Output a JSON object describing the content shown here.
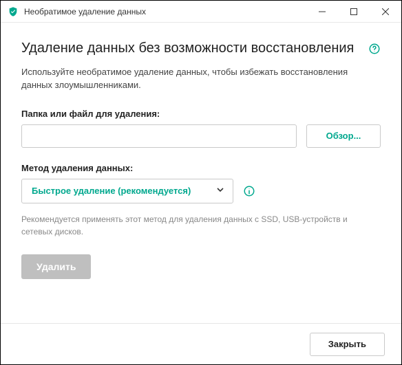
{
  "window": {
    "title": "Необратимое удаление данных"
  },
  "main": {
    "heading": "Удаление данных без возможности восстановления",
    "description": "Используйте необратимое удаление данных, чтобы избежать восстановления данных злоумышленниками.",
    "path_label": "Папка или файл для удаления:",
    "path_value": "",
    "browse_label": "Обзор...",
    "method_label": "Метод удаления данных:",
    "method_selected": "Быстрое удаление (рекомендуется)",
    "method_hint": "Рекомендуется применять этот метод для удаления данных с SSD, USB-устройств и сетевых дисков.",
    "delete_label": "Удалить"
  },
  "footer": {
    "close_label": "Закрыть"
  },
  "colors": {
    "accent": "#00a88e",
    "disabled": "#bfbfbf"
  }
}
